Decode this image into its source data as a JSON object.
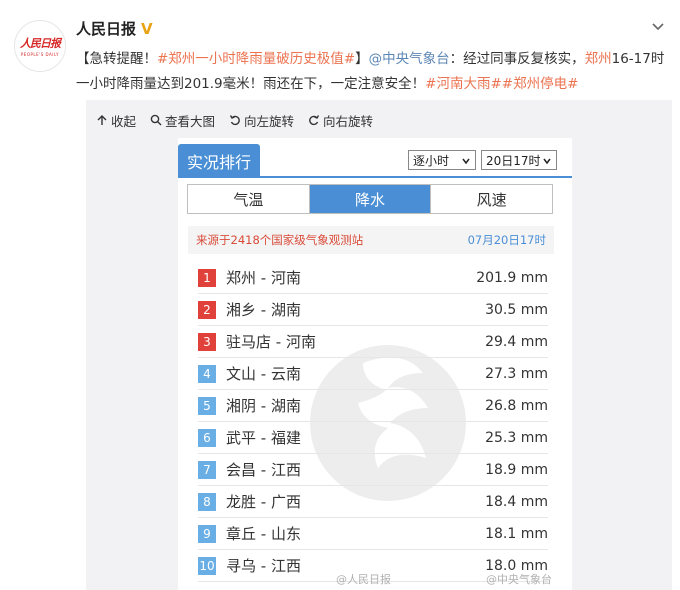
{
  "author": {
    "name": "人民日报",
    "avatar_logo": "人民日报",
    "avatar_sub": "PEOPLE'S DAILY",
    "verified_icon": "V"
  },
  "post": {
    "segments": [
      {
        "text": "【急转提醒！",
        "kind": "text"
      },
      {
        "text": "#郑州一小时降雨量破历史极值#",
        "kind": "tag"
      },
      {
        "text": "】",
        "kind": "text"
      },
      {
        "text": "@中央气象台",
        "kind": "mention"
      },
      {
        "text": "：经过同事反复核实，",
        "kind": "text"
      },
      {
        "text": "郑州",
        "kind": "tag"
      },
      {
        "text": "16-17时一小时降雨量达到201.9毫米！雨还在下，一定注意安全！",
        "kind": "text"
      },
      {
        "text": "#河南大雨#",
        "kind": "tag"
      },
      {
        "text": "#郑州停电#",
        "kind": "tag"
      }
    ]
  },
  "toolbar": {
    "collapse": "收起",
    "view_large": "查看大图",
    "rotate_left": "向左旋转",
    "rotate_right": "向右旋转"
  },
  "ranking": {
    "header_tab": "实况排行",
    "interval_select": "逐小时",
    "time_select": "20日17时",
    "segments": [
      "气温",
      "降水",
      "风速"
    ],
    "active_segment": "降水",
    "source": "来源于2418个国家级气象观测站",
    "date": "07月20日17时",
    "rows": [
      {
        "rank": "1",
        "place": "郑州 - 河南",
        "value": "201.9 mm",
        "color": "#e0413a"
      },
      {
        "rank": "2",
        "place": "湘乡 - 湖南",
        "value": "30.5 mm",
        "color": "#e0413a"
      },
      {
        "rank": "3",
        "place": "驻马店 - 河南",
        "value": "29.4 mm",
        "color": "#e0413a"
      },
      {
        "rank": "4",
        "place": "文山 - 云南",
        "value": "27.3 mm",
        "color": "#6aaee6"
      },
      {
        "rank": "5",
        "place": "湘阴 - 湖南",
        "value": "26.8 mm",
        "color": "#6aaee6"
      },
      {
        "rank": "6",
        "place": "武平 - 福建",
        "value": "25.3 mm",
        "color": "#6aaee6"
      },
      {
        "rank": "7",
        "place": "会昌 - 江西",
        "value": "18.9 mm",
        "color": "#6aaee6"
      },
      {
        "rank": "8",
        "place": "龙胜 - 广西",
        "value": "18.4 mm",
        "color": "#6aaee6"
      },
      {
        "rank": "9",
        "place": "章丘 - 山东",
        "value": "18.1 mm",
        "color": "#6aaee6"
      },
      {
        "rank": "10",
        "place": "寻乌 - 江西",
        "value": "18.0 mm",
        "color": "#6aaee6"
      }
    ],
    "watermark_left": "@人民日报",
    "watermark_right": "@中央气象台"
  }
}
